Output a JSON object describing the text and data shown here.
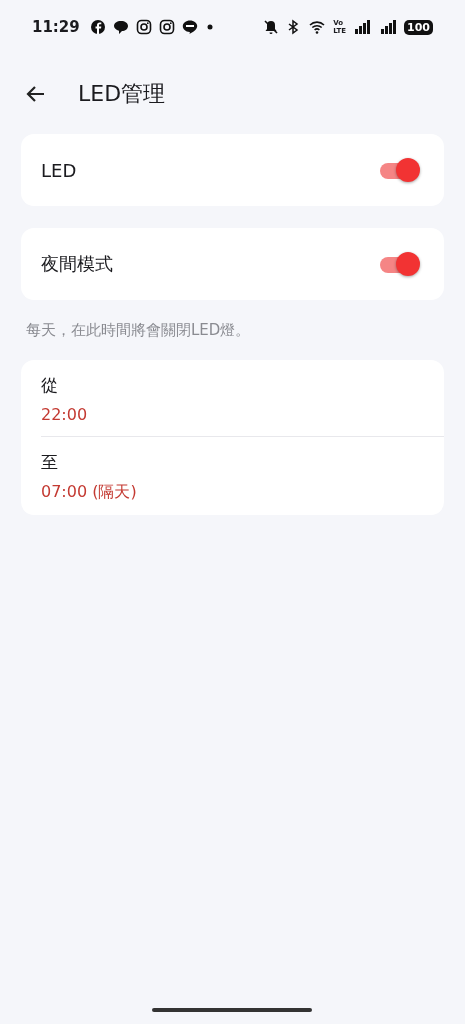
{
  "status_bar": {
    "time": "11:29",
    "volte": [
      "Vo",
      "LTE"
    ],
    "battery": "100"
  },
  "header": {
    "title": "LED管理"
  },
  "settings": [
    {
      "label": "LED",
      "on": true
    },
    {
      "label": "夜間模式",
      "on": true
    }
  ],
  "caption": "每天，在此時間將會關閉LED燈。",
  "schedule": [
    {
      "label": "從",
      "value": "22:00"
    },
    {
      "label": "至",
      "value": "07:00 (隔天)"
    }
  ]
}
